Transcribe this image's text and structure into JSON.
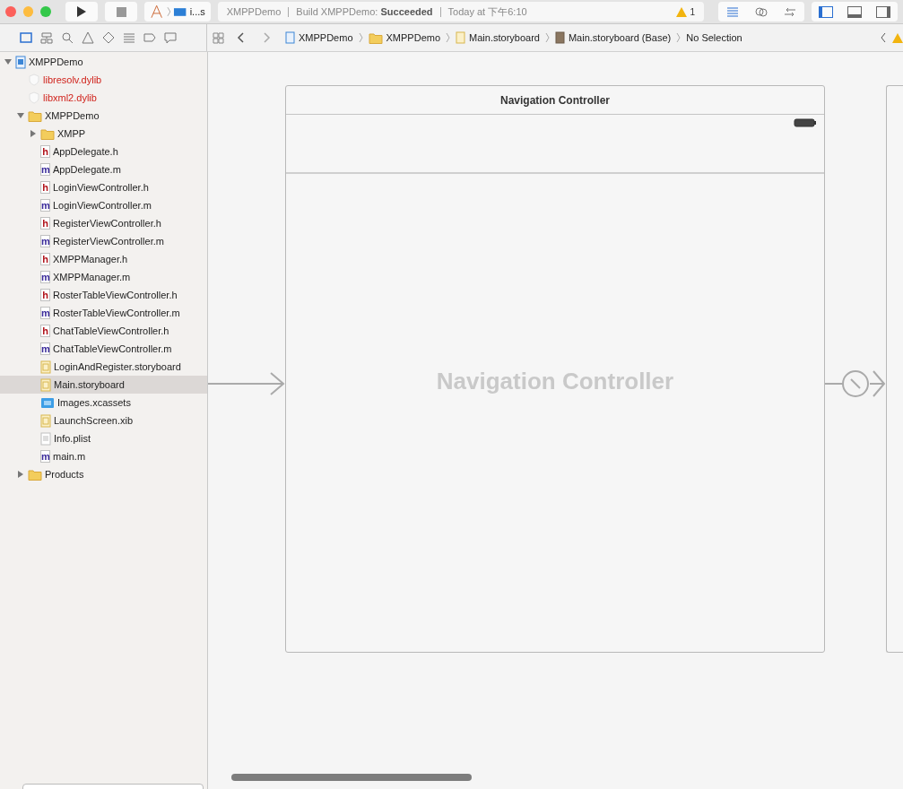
{
  "toolbar": {
    "scheme": "i...s",
    "activity": {
      "project": "XMPPDemo",
      "status": "Build XMPPDemo: **Succeeded**",
      "time": "Today at 下午6:10",
      "warnings": "1"
    },
    "editor_modes": [
      {
        "kind": "standard",
        "selected": true
      },
      {
        "kind": "assistant",
        "selected": false
      },
      {
        "kind": "version",
        "selected": false
      }
    ],
    "panels": [
      {
        "kind": "left",
        "on": true
      },
      {
        "kind": "bottom",
        "on": false
      },
      {
        "kind": "right",
        "on": false
      }
    ]
  },
  "navigator_tabs": [
    {
      "kind": "project",
      "selected": true
    },
    {
      "kind": "symbol",
      "selected": false
    },
    {
      "kind": "find",
      "selected": false
    },
    {
      "kind": "issue",
      "selected": false
    },
    {
      "kind": "test",
      "selected": false
    },
    {
      "kind": "debug",
      "selected": false
    },
    {
      "kind": "breakpoint",
      "selected": false
    },
    {
      "kind": "report",
      "selected": false
    }
  ],
  "breadcrumb": [
    {
      "kind": "project",
      "label": "XMPPDemo"
    },
    {
      "kind": "folder",
      "label": "XMPPDemo"
    },
    {
      "kind": "storyboard",
      "label": "Main.storyboard"
    },
    {
      "kind": "localized",
      "label": "Main.storyboard (Base)"
    },
    {
      "kind": "none",
      "label": "No Selection"
    }
  ],
  "tree": [
    {
      "kind": "project",
      "label": "XMPPDemo",
      "expanded": true,
      "selected": false,
      "missing": false,
      "children": [
        {
          "kind": "library",
          "label": "libresolv.dylib",
          "selected": false,
          "missing": true
        },
        {
          "kind": "library",
          "label": "libxml2.dylib",
          "selected": false,
          "missing": true
        },
        {
          "kind": "folder",
          "label": "XMPPDemo",
          "expanded": true,
          "selected": false,
          "missing": false,
          "children": [
            {
              "kind": "folder",
              "label": "XMPP",
              "expanded": false,
              "selected": false,
              "missing": false
            },
            {
              "kind": "header",
              "glyph": "h",
              "label": "AppDelegate.h",
              "selected": false,
              "missing": false
            },
            {
              "kind": "source",
              "glyph": "m",
              "label": "AppDelegate.m",
              "selected": false,
              "missing": false
            },
            {
              "kind": "header",
              "glyph": "h",
              "label": "LoginViewController.h",
              "selected": false,
              "missing": false
            },
            {
              "kind": "source",
              "glyph": "m",
              "label": "LoginViewController.m",
              "selected": false,
              "missing": false
            },
            {
              "kind": "header",
              "glyph": "h",
              "label": "RegisterViewController.h",
              "selected": false,
              "missing": false
            },
            {
              "kind": "source",
              "glyph": "m",
              "label": "RegisterViewController.m",
              "selected": false,
              "missing": false
            },
            {
              "kind": "header",
              "glyph": "h",
              "label": "XMPPManager.h",
              "selected": false,
              "missing": false
            },
            {
              "kind": "source",
              "glyph": "m",
              "label": "XMPPManager.m",
              "selected": false,
              "missing": false
            },
            {
              "kind": "header",
              "glyph": "h",
              "label": "RosterTableViewController.h",
              "selected": false,
              "missing": false
            },
            {
              "kind": "source",
              "glyph": "m",
              "label": "RosterTableViewController.m",
              "selected": false,
              "missing": false
            },
            {
              "kind": "header",
              "glyph": "h",
              "label": "ChatTableViewController.h",
              "selected": false,
              "missing": false
            },
            {
              "kind": "source",
              "glyph": "m",
              "label": "ChatTableViewController.m",
              "selected": false,
              "missing": false
            },
            {
              "kind": "storyboard",
              "label": "LoginAndRegister.storyboard",
              "selected": false,
              "missing": false
            },
            {
              "kind": "storyboard",
              "label": "Main.storyboard",
              "selected": true,
              "missing": false
            },
            {
              "kind": "assets",
              "label": "Images.xcassets",
              "selected": false,
              "missing": false
            },
            {
              "kind": "xib",
              "label": "LaunchScreen.xib",
              "selected": false,
              "missing": false
            },
            {
              "kind": "plist",
              "label": "Info.plist",
              "selected": false,
              "missing": false
            },
            {
              "kind": "source",
              "glyph": "m",
              "label": "main.m",
              "selected": false,
              "missing": false
            }
          ]
        },
        {
          "kind": "folder",
          "label": "Products",
          "expanded": false,
          "selected": false,
          "missing": false
        }
      ]
    }
  ],
  "canvas": {
    "scene_title": "Navigation Controller",
    "scene_placeholder": "Navigation Controller"
  }
}
